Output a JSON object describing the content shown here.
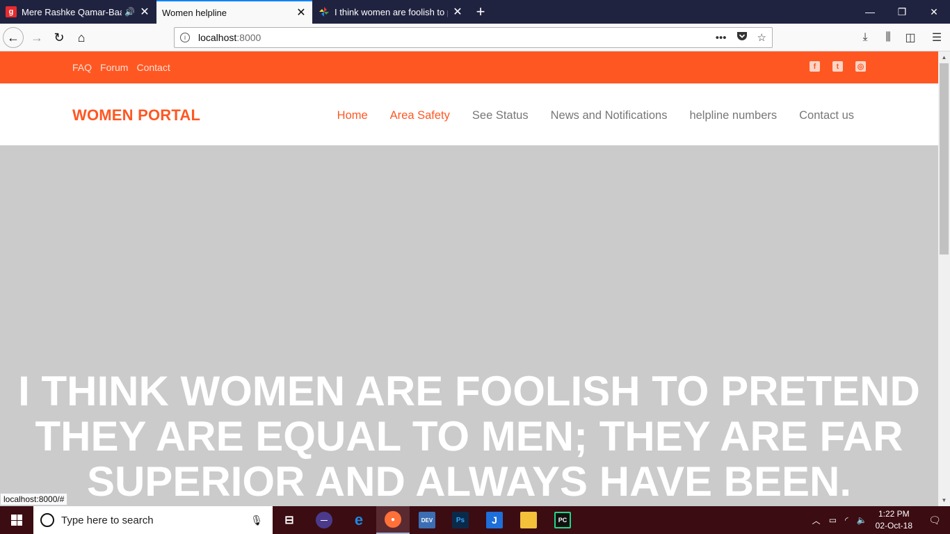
{
  "browser": {
    "tabs": [
      {
        "title": "Mere Rashke Qamar-Baadsh",
        "favicon": "gaana-icon",
        "favicon_letter": "g",
        "favicon_color": "#e72c30",
        "playing_audio": true,
        "active": false
      },
      {
        "title": "Women helpline",
        "favicon": "",
        "active": true
      },
      {
        "title": "I think women are foolish to pr",
        "favicon": "pinwheel-icon",
        "active": false
      }
    ],
    "url_host": "localhost",
    "url_port": ":8000",
    "status_url": "localhost:8000/#"
  },
  "site": {
    "top_links": [
      "FAQ",
      "Forum",
      "Contact"
    ],
    "social": [
      "facebook-icon",
      "twitter-icon",
      "instagram-icon"
    ],
    "brand": "WOMEN PORTAL",
    "menu": [
      {
        "label": "Home",
        "active": true
      },
      {
        "label": "Area Safety",
        "active": true
      },
      {
        "label": "See Status",
        "active": false
      },
      {
        "label": "News and Notifications",
        "active": false
      },
      {
        "label": "helpline numbers",
        "active": false
      },
      {
        "label": "Contact us",
        "active": false
      }
    ],
    "hero_lines": [
      "I THINK WOMEN ARE FOOLISH TO PRETEND",
      "THEY ARE EQUAL TO MEN; THEY ARE FAR",
      "SUPERIOR AND ALWAYS HAVE BEEN."
    ],
    "accent_color": "#ff5722"
  },
  "taskbar": {
    "search_placeholder": "Type here to search",
    "time": "1:22 PM",
    "date": "02-Oct-18",
    "apps": [
      {
        "name": "task-view-icon",
        "label": ""
      },
      {
        "name": "eclipse-icon",
        "label": ""
      },
      {
        "name": "edge-icon",
        "label": "e"
      },
      {
        "name": "firefox-icon",
        "label": ""
      },
      {
        "name": "devc-icon",
        "label": "DEV"
      },
      {
        "name": "photoshop-icon",
        "label": "Ps"
      },
      {
        "name": "jdeveloper-icon",
        "label": "J"
      },
      {
        "name": "file-explorer-icon",
        "label": ""
      },
      {
        "name": "pycharm-icon",
        "label": "PC"
      }
    ]
  }
}
